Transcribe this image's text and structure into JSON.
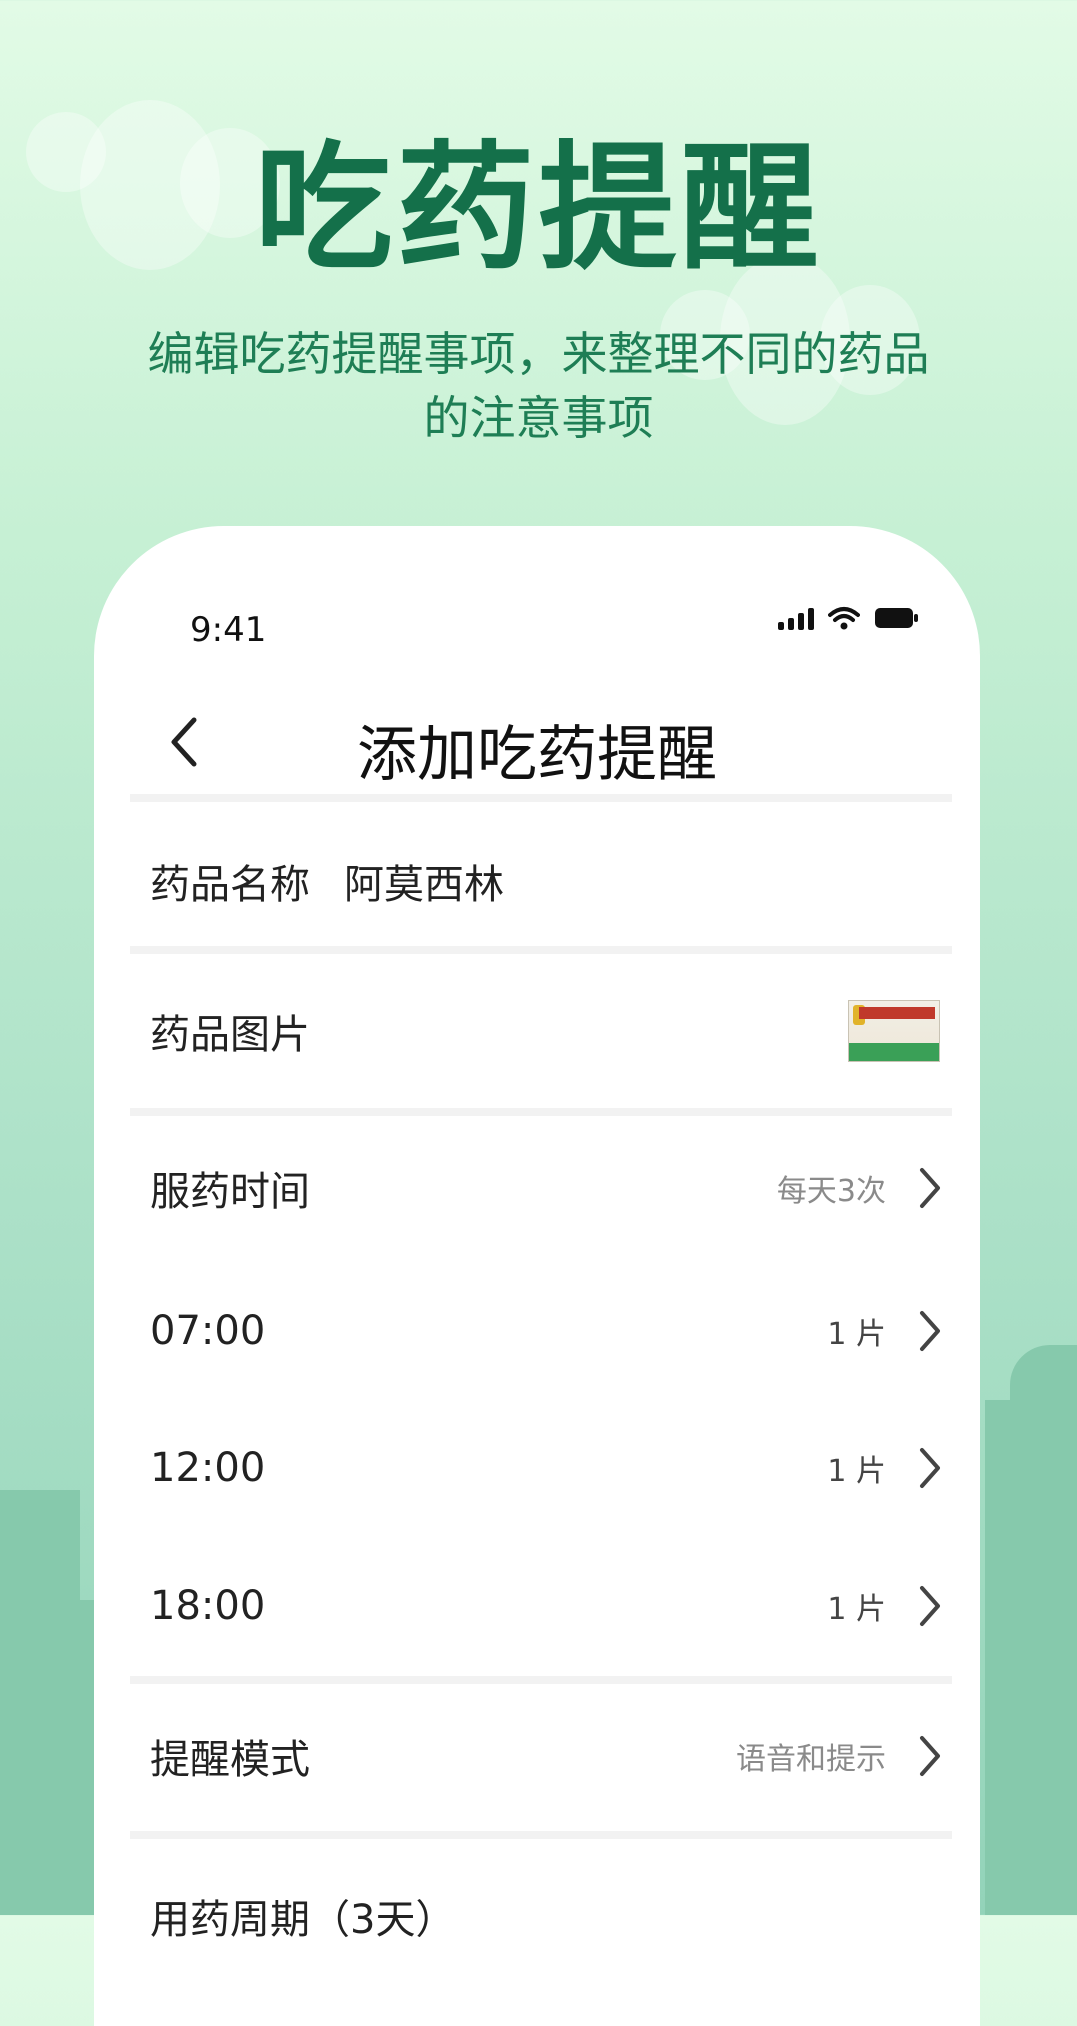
{
  "promo": {
    "headline": "吃药提醒",
    "subtitle_line1": "编辑吃药提醒事项，来整理不同的药品",
    "subtitle_line2": "的注意事项"
  },
  "status_bar": {
    "time": "9:41"
  },
  "nav": {
    "title": "添加吃药提醒"
  },
  "form": {
    "drug_name_label": "药品名称",
    "drug_name_value": "阿莫西林",
    "drug_image_label": "药品图片",
    "dose_time_label": "服药时间",
    "dose_time_value": "每天3次",
    "doses": [
      {
        "time": "07:00",
        "amount": "1 片"
      },
      {
        "time": "12:00",
        "amount": "1 片"
      },
      {
        "time": "18:00",
        "amount": "1 片"
      }
    ],
    "remind_mode_label": "提醒模式",
    "remind_mode_value": "语音和提示",
    "cycle_label": "用药周期（3天）"
  },
  "colors": {
    "headline": "#14704a",
    "subtitle": "#1e7e55",
    "background_top": "#e2fbe6",
    "background_bottom": "#93d3b9"
  }
}
